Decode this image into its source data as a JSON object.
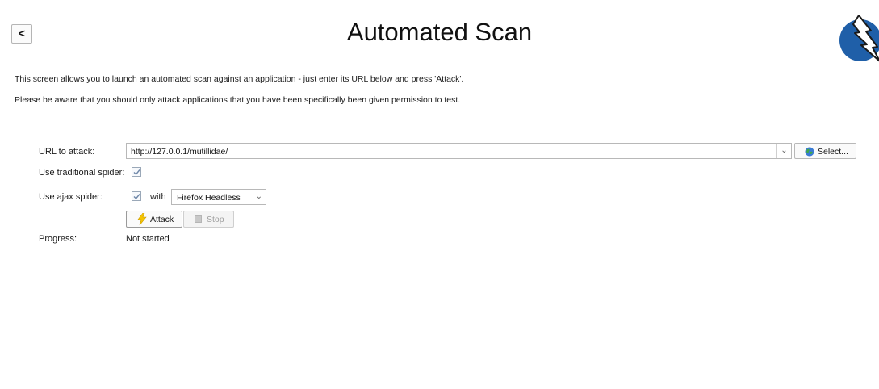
{
  "header": {
    "back_label": "<",
    "title": "Automated Scan",
    "logo_icon": "zap-lightning-logo"
  },
  "intro": {
    "line1": "This screen allows you to launch an automated scan against  an application - just enter its URL below and press 'Attack'.",
    "line2": "Please be aware that you should only attack applications that you have been specifically been given permission to test."
  },
  "form": {
    "url_label": "URL to attack:",
    "url_value": "http://127.0.0.1/mutillidae/",
    "select_label": "Select...",
    "traditional_label": "Use traditional spider:",
    "traditional_checked": true,
    "ajax_label": "Use ajax spider:",
    "ajax_checked": true,
    "with_label": "with",
    "browser_value": "Firefox Headless",
    "attack_label": "Attack",
    "stop_label": "Stop",
    "progress_label": "Progress:",
    "progress_value": "Not started"
  },
  "colors": {
    "logo_blue": "#1f5fa8",
    "bolt_yellow": "#f5c400"
  }
}
